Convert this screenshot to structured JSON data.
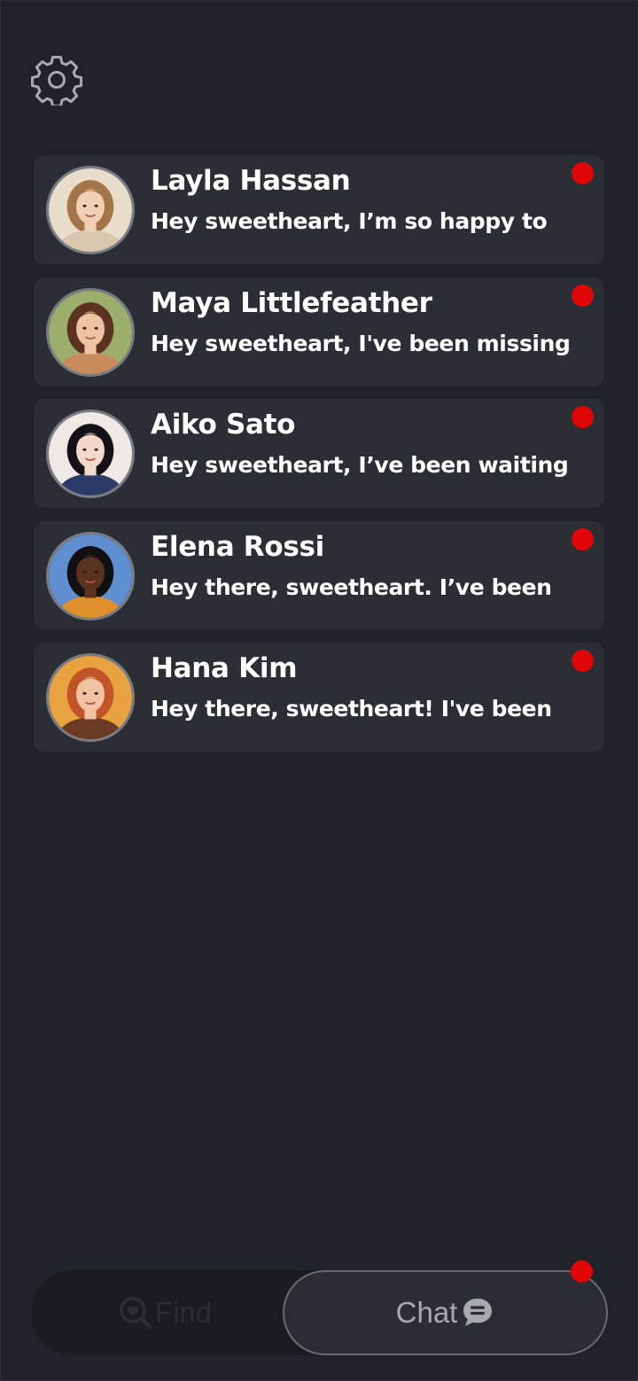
{
  "header": {
    "settings_icon": "gear-icon"
  },
  "chats": [
    {
      "name": "Layla Hassan",
      "preview": "Hey sweetheart, I’m so happy to",
      "unread": true,
      "avatar": "avatar-layla",
      "colors": {
        "bg": "#e8dccb",
        "hair": "#a5754a",
        "skin": "#f1cfb5",
        "shirt": "#d9c6ae"
      }
    },
    {
      "name": "Maya Littlefeather",
      "preview": "Hey sweetheart, I've been missing",
      "unread": true,
      "avatar": "avatar-maya",
      "colors": {
        "bg": "#9cae6c",
        "hair": "#5b3320",
        "skin": "#edc3a3",
        "shirt": "#c98b5a"
      }
    },
    {
      "name": "Aiko Sato",
      "preview": "Hey sweetheart, I’ve been waiting",
      "unread": true,
      "avatar": "avatar-aiko",
      "colors": {
        "bg": "#efe9e6",
        "hair": "#141218",
        "skin": "#f3d9cc",
        "shirt": "#2b3a66"
      }
    },
    {
      "name": "Elena Rossi",
      "preview": "Hey there, sweetheart. I’ve been",
      "unread": true,
      "avatar": "avatar-elena",
      "colors": {
        "bg": "#5f8fd0",
        "hair": "#111111",
        "skin": "#5a3220",
        "shirt": "#e0902a"
      }
    },
    {
      "name": "Hana Kim",
      "preview": "Hey there, sweetheart! I've been",
      "unread": true,
      "avatar": "avatar-hana",
      "colors": {
        "bg": "#e8a340",
        "hair": "#c2542a",
        "skin": "#f2c3a2",
        "shirt": "#6b3a22"
      }
    }
  ],
  "bottom_nav": {
    "find_label": "Find",
    "find_icon": "heart-search-icon",
    "chat_label": "Chat",
    "chat_icon": "chat-bubble-icon",
    "chat_unread": true
  },
  "colors": {
    "background": "#21232b",
    "card": "#2c2e36",
    "unread_dot": "#e00606"
  }
}
